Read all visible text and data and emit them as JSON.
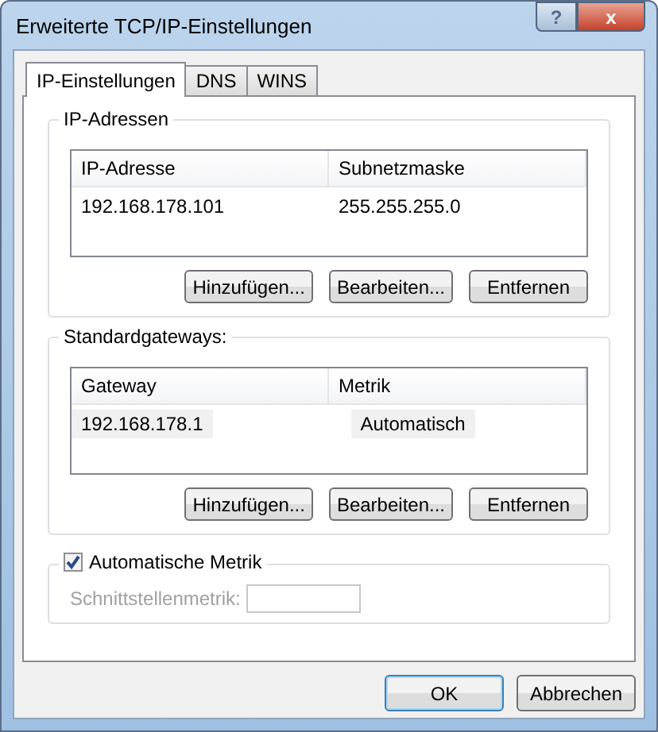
{
  "window": {
    "title": "Erweiterte TCP/IP-Einstellungen",
    "help_button": "?",
    "close_button": "x"
  },
  "tabs": [
    {
      "label": "IP-Einstellungen",
      "selected": true
    },
    {
      "label": "DNS",
      "selected": false
    },
    {
      "label": "WINS",
      "selected": false
    }
  ],
  "groups": [
    {
      "title": "IP-Adressen",
      "columns": [
        "IP-Adresse",
        "Subnetzmaske"
      ],
      "rows": [
        {
          "cells": [
            "192.168.178.101",
            "255.255.255.0"
          ],
          "selected": false
        }
      ],
      "buttons": [
        "Hinzufügen...",
        "Bearbeiten...",
        "Entfernen"
      ]
    },
    {
      "title": "Standardgateways:",
      "columns": [
        "Gateway",
        "Metrik"
      ],
      "rows": [
        {
          "cells": [
            "192.168.178.1",
            "Automatisch"
          ],
          "selected": true
        }
      ],
      "buttons": [
        "Hinzufügen...",
        "Bearbeiten...",
        "Entfernen"
      ]
    }
  ],
  "metric": {
    "label": "Automatische Metrik",
    "checked": true,
    "field_label": "Schnittstellenmetrik:",
    "field_disabled": true
  },
  "buttons": [
    {
      "label": "OK",
      "default": true
    },
    {
      "label": "Abbrechen",
      "default": false
    }
  ]
}
